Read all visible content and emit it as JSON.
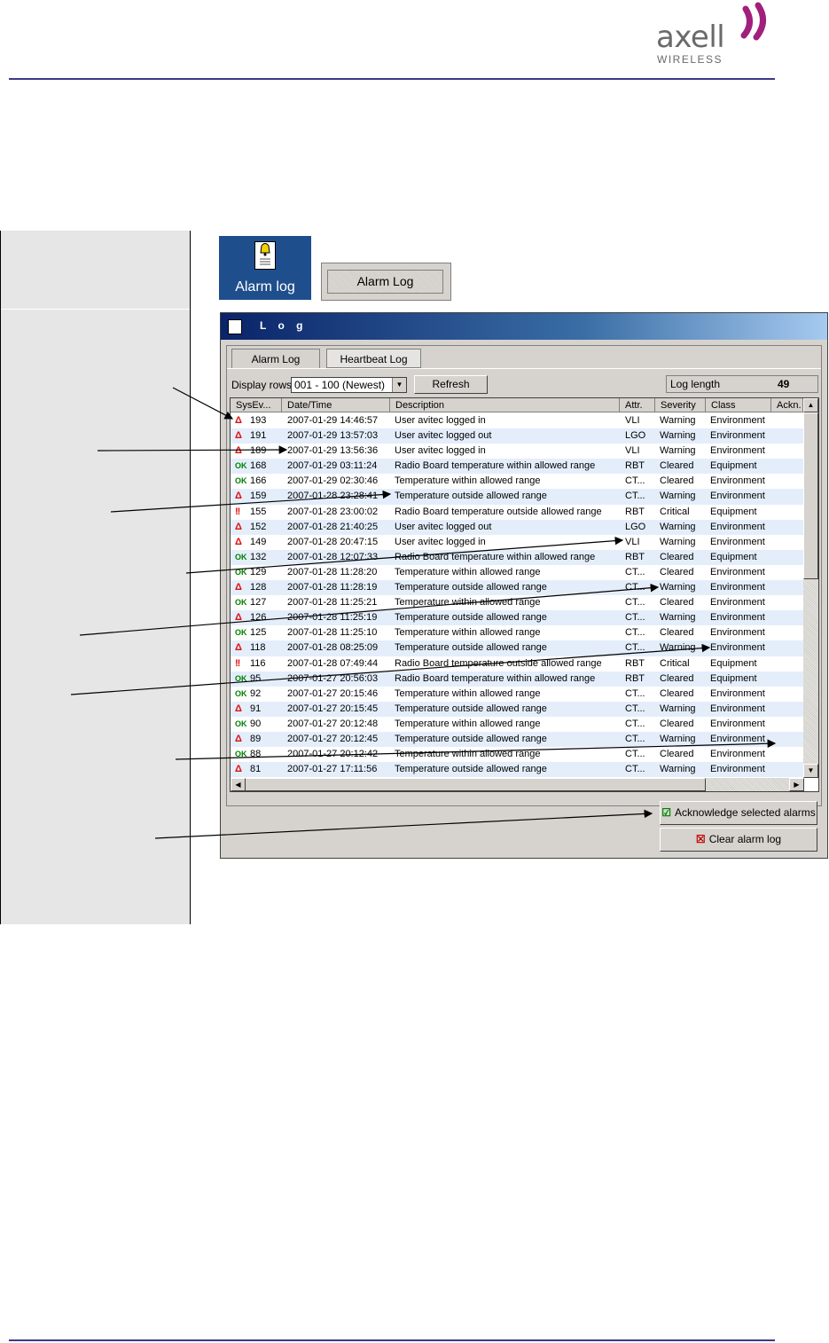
{
  "logo": {
    "brand": "axell",
    "sub": "WIRELESS"
  },
  "toolbar": {
    "icon_button_label": "Alarm log",
    "text_button_label": "Alarm Log"
  },
  "window": {
    "title": "L o g"
  },
  "tabs": [
    {
      "label": "Alarm Log"
    },
    {
      "label": "Heartbeat Log"
    }
  ],
  "controls": {
    "display_rows_label": "Display rows",
    "display_rows_value": "001 - 100  (Newest)",
    "refresh_label": "Refresh",
    "log_length_label": "Log length",
    "log_length_value": "49"
  },
  "columns": [
    "SysEv...",
    "Date/Time",
    "Description",
    "Attr.",
    "Severity",
    "Class",
    "Ackn."
  ],
  "rows": [
    {
      "icon": "warning-icon",
      "glyph": "Δ",
      "id": "193",
      "datetime": "2007-01-29  14:46:57",
      "desc": "User avitec logged in",
      "attr": "VLI",
      "severity": "Warning",
      "class": "Environment"
    },
    {
      "icon": "warning-icon",
      "glyph": "Δ",
      "id": "191",
      "datetime": "2007-01-29  13:57:03",
      "desc": "User avitec logged out",
      "attr": "LGO",
      "severity": "Warning",
      "class": "Environment"
    },
    {
      "icon": "warning-icon",
      "glyph": "Δ",
      "id": "189",
      "datetime": "2007-01-29  13:56:36",
      "desc": "User avitec logged in",
      "attr": "VLI",
      "severity": "Warning",
      "class": "Environment"
    },
    {
      "icon": "ok-icon",
      "glyph": "OK",
      "id": "168",
      "datetime": "2007-01-29  03:11:24",
      "desc": "Radio Board temperature within allowed range",
      "attr": "RBT",
      "severity": "Cleared",
      "class": "Equipment"
    },
    {
      "icon": "ok-icon",
      "glyph": "OK",
      "id": "166",
      "datetime": "2007-01-29  02:30:46",
      "desc": "Temperature within allowed range",
      "attr": "CT...",
      "severity": "Cleared",
      "class": "Environment"
    },
    {
      "icon": "warning-icon",
      "glyph": "Δ",
      "id": "159",
      "datetime": "2007-01-28  23:28:41",
      "desc": "Temperature outside allowed range",
      "attr": "CT...",
      "severity": "Warning",
      "class": "Environment"
    },
    {
      "icon": "critical-icon",
      "glyph": "!!",
      "id": "155",
      "datetime": "2007-01-28  23:00:02",
      "desc": "Radio Board temperature outside allowed range",
      "attr": "RBT",
      "severity": "Critical",
      "class": "Equipment"
    },
    {
      "icon": "warning-icon",
      "glyph": "Δ",
      "id": "152",
      "datetime": "2007-01-28  21:40:25",
      "desc": "User avitec logged out",
      "attr": "LGO",
      "severity": "Warning",
      "class": "Environment"
    },
    {
      "icon": "warning-icon",
      "glyph": "Δ",
      "id": "149",
      "datetime": "2007-01-28  20:47:15",
      "desc": "User avitec logged in",
      "attr": "VLI",
      "severity": "Warning",
      "class": "Environment"
    },
    {
      "icon": "ok-icon",
      "glyph": "OK",
      "id": "132",
      "datetime": "2007-01-28  12:07:33",
      "desc": "Radio Board temperature within allowed range",
      "attr": "RBT",
      "severity": "Cleared",
      "class": "Equipment"
    },
    {
      "icon": "ok-icon",
      "glyph": "OK",
      "id": "129",
      "datetime": "2007-01-28  11:28:20",
      "desc": "Temperature within allowed range",
      "attr": "CT...",
      "severity": "Cleared",
      "class": "Environment"
    },
    {
      "icon": "warning-icon",
      "glyph": "Δ",
      "id": "128",
      "datetime": "2007-01-28  11:28:19",
      "desc": "Temperature outside allowed range",
      "attr": "CT...",
      "severity": "Warning",
      "class": "Environment"
    },
    {
      "icon": "ok-icon",
      "glyph": "OK",
      "id": "127",
      "datetime": "2007-01-28  11:25:21",
      "desc": "Temperature within allowed range",
      "attr": "CT...",
      "severity": "Cleared",
      "class": "Environment"
    },
    {
      "icon": "warning-icon",
      "glyph": "Δ",
      "id": "126",
      "datetime": "2007-01-28  11:25:19",
      "desc": "Temperature outside allowed range",
      "attr": "CT...",
      "severity": "Warning",
      "class": "Environment"
    },
    {
      "icon": "ok-icon",
      "glyph": "OK",
      "id": "125",
      "datetime": "2007-01-28  11:25:10",
      "desc": "Temperature within allowed range",
      "attr": "CT...",
      "severity": "Cleared",
      "class": "Environment"
    },
    {
      "icon": "warning-icon",
      "glyph": "Δ",
      "id": "118",
      "datetime": "2007-01-28  08:25:09",
      "desc": "Temperature outside allowed range",
      "attr": "CT...",
      "severity": "Warning",
      "class": "Environment"
    },
    {
      "icon": "critical-icon",
      "glyph": "!!",
      "id": "116",
      "datetime": "2007-01-28  07:49:44",
      "desc": "Radio Board temperature outside allowed range",
      "attr": "RBT",
      "severity": "Critical",
      "class": "Equipment"
    },
    {
      "icon": "ok-icon",
      "glyph": "OK",
      "id": "95",
      "datetime": "2007-01-27  20:56:03",
      "desc": "Radio Board temperature within allowed range",
      "attr": "RBT",
      "severity": "Cleared",
      "class": "Equipment"
    },
    {
      "icon": "ok-icon",
      "glyph": "OK",
      "id": "92",
      "datetime": "2007-01-27  20:15:46",
      "desc": "Temperature within allowed range",
      "attr": "CT...",
      "severity": "Cleared",
      "class": "Environment"
    },
    {
      "icon": "warning-icon",
      "glyph": "Δ",
      "id": "91",
      "datetime": "2007-01-27  20:15:45",
      "desc": "Temperature outside allowed range",
      "attr": "CT...",
      "severity": "Warning",
      "class": "Environment"
    },
    {
      "icon": "ok-icon",
      "glyph": "OK",
      "id": "90",
      "datetime": "2007-01-27  20:12:48",
      "desc": "Temperature within allowed range",
      "attr": "CT...",
      "severity": "Cleared",
      "class": "Environment"
    },
    {
      "icon": "warning-icon",
      "glyph": "Δ",
      "id": "89",
      "datetime": "2007-01-27  20:12:45",
      "desc": "Temperature outside allowed range",
      "attr": "CT...",
      "severity": "Warning",
      "class": "Environment"
    },
    {
      "icon": "ok-icon",
      "glyph": "OK",
      "id": "88",
      "datetime": "2007-01-27  20:12:42",
      "desc": "Temperature within allowed range",
      "attr": "CT...",
      "severity": "Cleared",
      "class": "Environment"
    },
    {
      "icon": "warning-icon",
      "glyph": "Δ",
      "id": "81",
      "datetime": "2007-01-27  17:11:56",
      "desc": "Temperature outside allowed range",
      "attr": "CT...",
      "severity": "Warning",
      "class": "Environment"
    }
  ],
  "actions": {
    "acknowledge_label": "Acknowledge selected alarms",
    "clear_label": "Clear alarm log"
  },
  "colors": {
    "rule": "#3a3a8c",
    "logo_accent": "#a0207c",
    "title_bar": "#0a246a",
    "row_alt": "#e4eefb"
  }
}
